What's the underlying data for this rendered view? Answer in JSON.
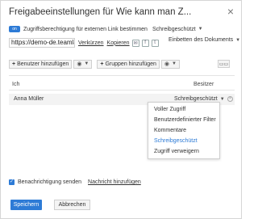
{
  "dialog": {
    "title": "Freigabeeinstellungen für Wie kann man Z...",
    "close_glyph": "×"
  },
  "external_link": {
    "toggle_label": "on",
    "label": "Zugriffsberechtigung für externen Link bestimmen",
    "mode": "Schreibgeschützt",
    "url": "https://demo-de.teamlab",
    "shorten": "Verkürzen",
    "copy": "Kopieren",
    "embed": "Einbetten des Dokuments"
  },
  "toolbar": {
    "add_users": "Benutzer hinzufügen",
    "add_groups": "Gruppen hinzufügen"
  },
  "table": {
    "col_me": "Ich",
    "col_owner": "Besitzer",
    "user_name": "Anna Müller",
    "user_permission": "Schreibgeschützt"
  },
  "permission_menu": {
    "items": [
      "Voller Zugriff",
      "Benutzerdefinierter Filter",
      "Kommentare",
      "Schreibgeschützt",
      "Zugriff verweigern"
    ],
    "selected_index": 3
  },
  "footer": {
    "notify_label": "Benachrichtigung senden",
    "add_message": "Nachricht hinzufügen",
    "save": "Speichern",
    "cancel": "Abbrechen"
  },
  "colors": {
    "accent": "#2d7bd6"
  }
}
